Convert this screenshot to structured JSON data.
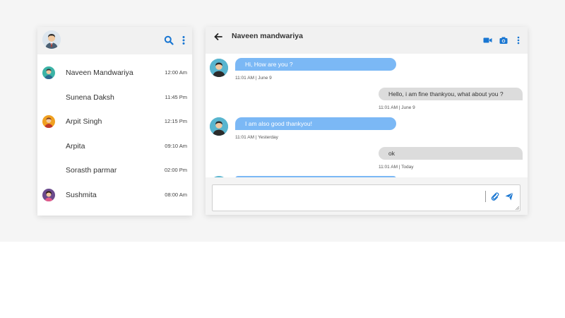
{
  "contacts": [
    {
      "name": "Naveen Mandwariya",
      "time": "12:00 Am",
      "avatar": "avatar-teal"
    },
    {
      "name": "Sunena Daksh",
      "time": "11:45 Pm",
      "avatar": ""
    },
    {
      "name": "Arpit Singh",
      "time": "12:15 Pm",
      "avatar": "avatar-orange"
    },
    {
      "name": "Arpita",
      "time": "09:10 Am",
      "avatar": ""
    },
    {
      "name": "Sorasth parmar",
      "time": "02:00 Pm",
      "avatar": ""
    },
    {
      "name": "Sushmita",
      "time": "08:00 Am",
      "avatar": "avatar-purple"
    }
  ],
  "chat": {
    "title": "Naveen mandwariya",
    "messages": [
      {
        "direction": "in",
        "text": "Hi, How are you ?",
        "stamp": "11:01 AM | June 9"
      },
      {
        "direction": "out",
        "text": "Hello, i am fine thankyou, what about you ?",
        "stamp": "11:01 AM | June 9"
      },
      {
        "direction": "in",
        "text": "I am also good thankyou!",
        "stamp": "11:01 AM | Yesterday"
      },
      {
        "direction": "out",
        "text": "ok",
        "stamp": "11:01 AM | Today"
      }
    ],
    "input_value": ""
  },
  "icons": {
    "search": "search-icon",
    "menu": "more-vertical-icon",
    "back": "arrow-left-icon",
    "video": "video-camera-icon",
    "camera": "camera-icon",
    "attach": "paperclip-icon",
    "send": "send-icon"
  },
  "colors": {
    "accent": "#1976d2",
    "incoming_bubble": "#7bb8f5",
    "outgoing_bubble": "#dcdcdc",
    "header_bg": "#f1f1f1"
  }
}
